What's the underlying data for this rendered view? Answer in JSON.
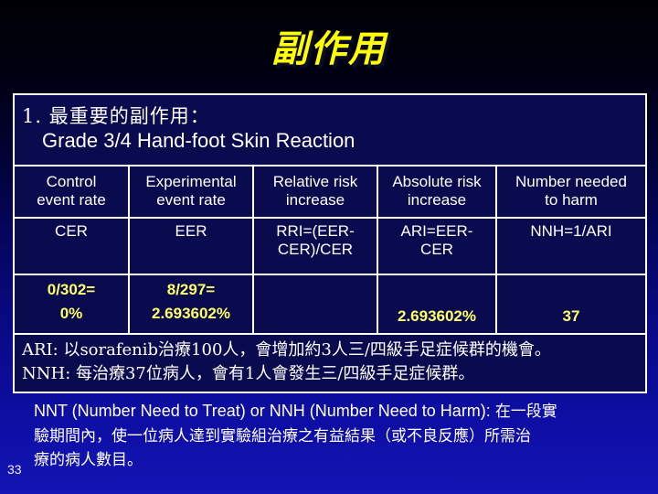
{
  "slide": {
    "title": "副作用",
    "page_number": "33",
    "accent_yellow": "#ffff66",
    "title_yellow": "#ffff00",
    "text_white": "#ffffff",
    "background_top": "#000004",
    "background_bottom": "#1414b4",
    "cell_background": "#0a0a4e"
  },
  "heading": {
    "line1": "1. 最重要的副作用：",
    "line2": "Grade 3/4  Hand-foot Skin Reaction"
  },
  "table": {
    "columns": [
      {
        "line1": "Control",
        "line2": "event rate"
      },
      {
        "line1": "Experimental",
        "line2": "event rate"
      },
      {
        "line1": "Relative risk",
        "line2": "increase"
      },
      {
        "line1": "Absolute risk",
        "line2": "increase"
      },
      {
        "line1": "Number needed",
        "line2": "to harm"
      }
    ],
    "formula_row": [
      {
        "line1": "CER",
        "line2": ""
      },
      {
        "line1": "EER",
        "line2": ""
      },
      {
        "line1": "RRI=(EER-",
        "line2": "CER)/CER"
      },
      {
        "line1": "ARI=EER-",
        "line2": "CER"
      },
      {
        "line1": "NNH=1/ARI",
        "line2": ""
      }
    ],
    "value_row": [
      {
        "line1": "0/302=",
        "line2": "0%"
      },
      {
        "line1": "8/297=",
        "line2": "2.693602%"
      },
      {
        "line1": "",
        "line2": ""
      },
      {
        "line1": "",
        "line2": "2.693602%"
      },
      {
        "line1": "",
        "line2": "37"
      }
    ],
    "notes": [
      "ARI: 以sorafenib治療100人，會增加約3人三/四級手足症候群的機會。",
      "NNH: 每治療37位病人，會有1人會發生三/四級手足症候群。"
    ]
  },
  "footnote": {
    "line1_en": "NNT (Number Need to Treat) or NNH (Number Need to Harm): ",
    "line1_cjk": "在一段實",
    "line2": "驗期間內，使一位病人達到實驗組治療之有益結果（或不良反應）所需治",
    "line3": "療的病人數目。"
  }
}
